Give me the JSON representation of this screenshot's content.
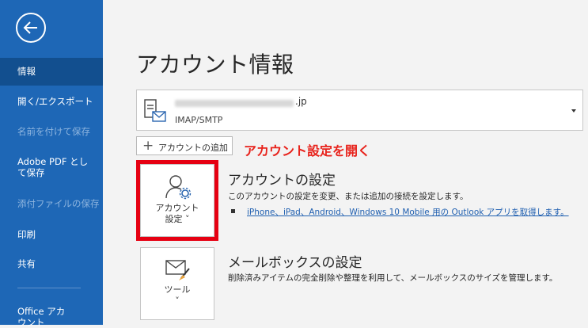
{
  "sidebar": {
    "items": [
      {
        "label": "情報"
      },
      {
        "label": "開く/エクスポート"
      },
      {
        "label": "名前を付けて保存"
      },
      {
        "label": "Adobe PDF として保存"
      },
      {
        "label": "添付ファイルの保存"
      },
      {
        "label": "印刷"
      },
      {
        "label": "共有"
      },
      {
        "label": "Office アカウント"
      }
    ]
  },
  "main": {
    "title": "アカウント情報",
    "account": {
      "email_suffix": ".jp",
      "type": "IMAP/SMTP"
    },
    "add_account_label": "アカウントの追加",
    "annotation": "アカウント設定を開く",
    "account_settings": {
      "tile_line1": "アカウント",
      "tile_line2": "設定 ˅",
      "title": "アカウントの設定",
      "description": "このアカウントの設定を変更、または追加の接続を設定します。",
      "link": "iPhone、iPad、Android、Windows 10 Mobile 用の Outlook アプリを取得します。"
    },
    "mailbox_settings": {
      "tile_line1": "ツール",
      "tile_line2": "˅",
      "title": "メールボックスの設定",
      "description": "削除済みアイテムの完全削除や整理を利用して、メールボックスのサイズを管理します。"
    }
  },
  "colors": {
    "sidebar": "#1e67b6",
    "sidebar_selected": "#124f8f",
    "highlight": "#e60012",
    "annotation": "#e8221b",
    "link": "#1f5fb0"
  }
}
